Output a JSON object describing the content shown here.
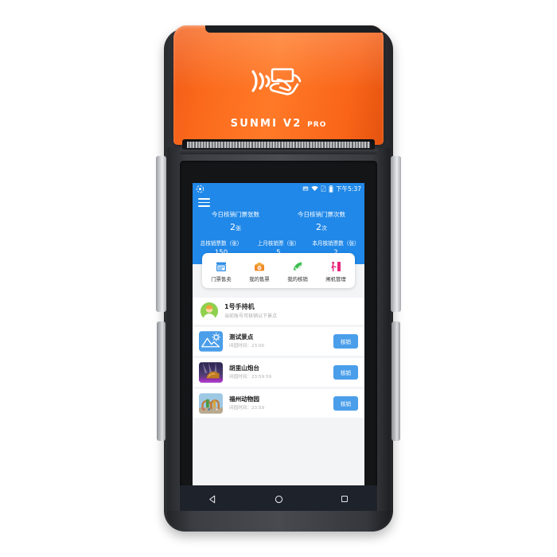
{
  "device": {
    "brand_name": "SUNMI V2",
    "brand_suffix": "PRO",
    "nfc_icon": "contactless-nfc-icon",
    "colors": {
      "shell_orange": "#ff7a28",
      "body_dark": "#3c3e43"
    }
  },
  "statusbar": {
    "left_icon": "app-notification-icon",
    "icons": [
      "screenshot-icon",
      "wifi-icon",
      "sim-card-icon",
      "battery-icon"
    ],
    "clock": "下午5:37",
    "background": "#2088e8"
  },
  "header": {
    "menu_icon": "hamburger-menu-icon",
    "today": [
      {
        "label": "今日核销门票张数",
        "value": "2",
        "unit": "张"
      },
      {
        "label": "今日核销门票次数",
        "value": "2",
        "unit": "次"
      }
    ],
    "totals": [
      {
        "label": "总核销票数（张）",
        "value": "150"
      },
      {
        "label": "上月核销票（张）",
        "value": "5"
      },
      {
        "label": "本月核销票数（张）",
        "value": "2"
      }
    ]
  },
  "quick_menu": [
    {
      "label": "门票售卖",
      "icon": "ticket-machine-icon",
      "color": "#2f8fe8"
    },
    {
      "label": "我的售票",
      "icon": "wallet-ticket-icon",
      "color": "#f08a2a"
    },
    {
      "label": "我的核销",
      "icon": "check-leaf-icon",
      "color": "#3fbf54"
    },
    {
      "label": "闸机管理",
      "icon": "turnstile-gate-icon",
      "color": "#e8247a"
    }
  ],
  "account": {
    "avatar": "user-avatar",
    "name": "1号手持机",
    "subtitle": "当前账号可核销以下景点"
  },
  "spots": [
    {
      "name": "测试景点",
      "time": "闭园时间：23:00",
      "button": "核销",
      "thumb": "mountain-sun-illustration"
    },
    {
      "name": "胡里山炮台",
      "time": "闭园时间：23:59:59",
      "button": "核销",
      "thumb": "fortress-night-photo"
    },
    {
      "name": "福州动物园",
      "time": "闭园时间：23:59",
      "button": "核销",
      "thumb": "zoo-gate-photo"
    }
  ],
  "navbar": {
    "back": "back-triangle-icon",
    "home": "home-circle-icon",
    "recents": "recents-square-icon"
  }
}
